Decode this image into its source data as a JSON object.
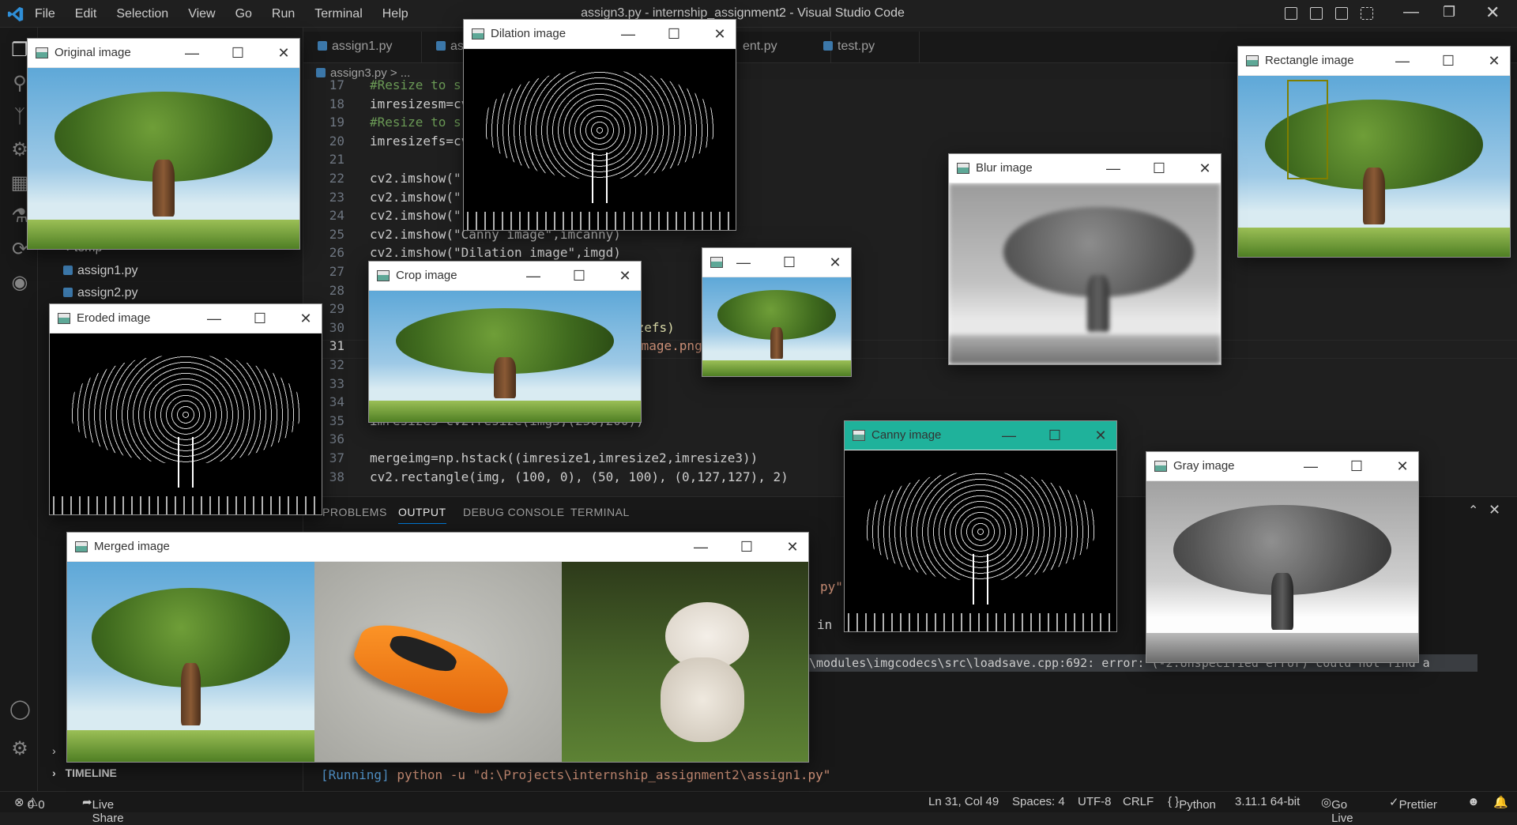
{
  "titlebar": {
    "title": "assign3.py - internship_assignment2 - Visual Studio Code",
    "menu": [
      "File",
      "Edit",
      "Selection",
      "View",
      "Go",
      "Run",
      "Terminal",
      "Help"
    ]
  },
  "sidebar": {
    "files": [
      {
        "name": "temp",
        "type": "folder"
      },
      {
        "name": "assign1.py",
        "type": "python"
      },
      {
        "name": "assign2.py",
        "type": "python"
      }
    ],
    "timeline_label": "TIMELINE"
  },
  "tabs": [
    {
      "label": "assign1.py"
    },
    {
      "label": "as"
    },
    {
      "label": "ent.py"
    },
    {
      "label": "test.py"
    }
  ],
  "breadcrumb": "assign3.py > ...",
  "editor": {
    "lines": [
      {
        "n": "17",
        "code": "#Resize to s"
      },
      {
        "n": "18",
        "code": "imresizesm=cv"
      },
      {
        "n": "19",
        "code": "#Resize to s"
      },
      {
        "n": "20",
        "code": "imresizefs=cv"
      },
      {
        "n": "21",
        "code": ""
      },
      {
        "n": "22",
        "code": "cv2.imshow(\""
      },
      {
        "n": "23",
        "code": "cv2.imshow(\""
      },
      {
        "n": "24",
        "code": "cv2.imshow(\""
      },
      {
        "n": "25",
        "code": "cv2.imshow(\"Canny image\",imcanny)"
      },
      {
        "n": "26",
        "code": "cv2.imshow(\"Dilation image\",imgd)"
      },
      {
        "n": "27",
        "code": ""
      },
      {
        "n": "28",
        "code": ""
      },
      {
        "n": "29",
        "code": ")"
      },
      {
        "n": "30",
        "code": "izefs)"
      },
      {
        "n": "31",
        "code": "image.png"
      },
      {
        "n": "32",
        "code": ""
      },
      {
        "n": "33",
        "code": ""
      },
      {
        "n": "34",
        "code": ""
      },
      {
        "n": "35",
        "code": "imresize3=cv2.resize(img3,(250,200))"
      },
      {
        "n": "36",
        "code": ""
      },
      {
        "n": "37",
        "code": "mergeimg=np.hstack((imresize1,imresize2,imresize3))"
      },
      {
        "n": "38",
        "code": "cv2.rectangle(img, (100, 0), (50, 100), (0,127,127), 2)"
      }
    ]
  },
  "panel": {
    "tabs": [
      "PROBLEMS",
      "OUTPUT",
      "DEBUG CONSOLE",
      "TERMINAL"
    ],
    "active_tab": "OUTPUT",
    "output_fragments": [
      {
        "text": "py\""
      },
      {
        "text": "in"
      },
      {
        "text": "\\modules\\imgcodecs\\src\\loadsave.cpp:692: error: (-2:Unspecified error) could not find a"
      }
    ],
    "running_tag": "[Running]",
    "running_cmd": " python -u \"d:\\Projects\\internship_assignment2\\assign1.py\""
  },
  "windows": [
    {
      "title": "Original image"
    },
    {
      "title": "Dilation image"
    },
    {
      "title": "Rectangle image"
    },
    {
      "title": "Blur image"
    },
    {
      "title": "Crop image"
    },
    {
      "title": ""
    },
    {
      "title": "Eroded image"
    },
    {
      "title": "Canny image"
    },
    {
      "title": "Gray image"
    },
    {
      "title": "Merged image"
    }
  ],
  "statusbar": {
    "errors": "0",
    "warnings": "0",
    "live_share": "Live Share",
    "position": "Ln 31, Col 49",
    "spaces": "Spaces: 4",
    "encoding": "UTF-8",
    "eol": "CRLF",
    "language": "Python",
    "interpreter": "3.11.1 64-bit",
    "go_live": "Go Live",
    "prettier": "Prettier"
  },
  "colors": {
    "accent": "#1fb29b",
    "background": "#1e1e1e",
    "vscode_blue": "#3c78aa"
  }
}
